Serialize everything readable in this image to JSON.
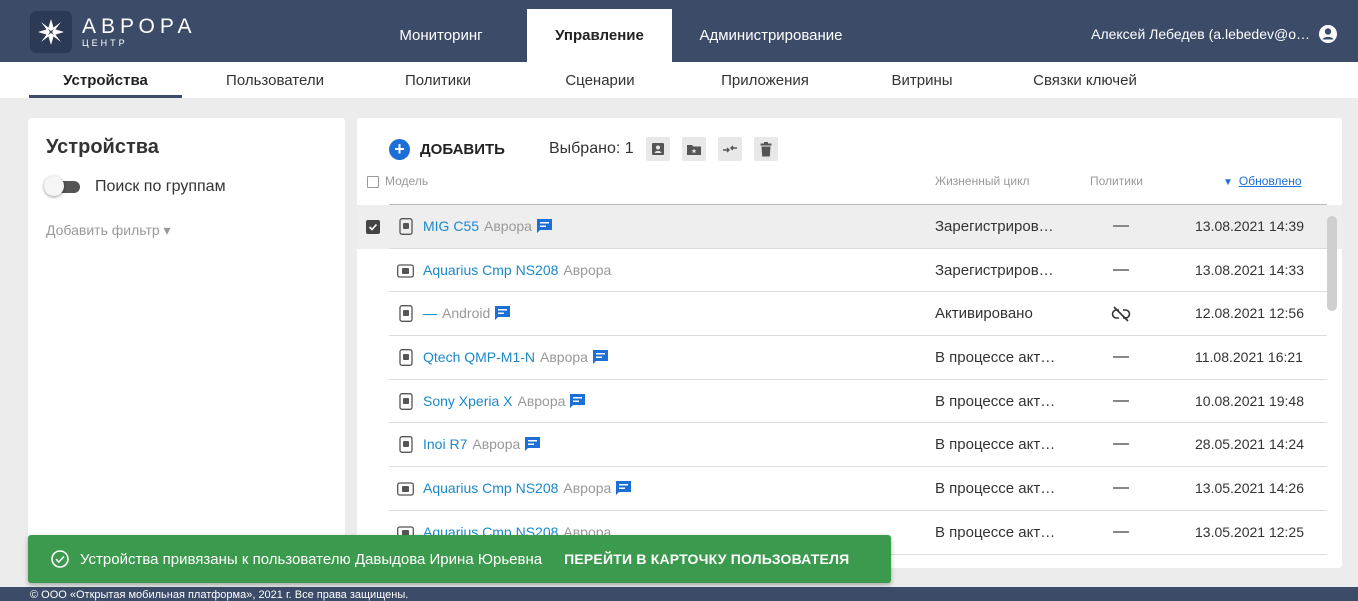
{
  "brand": {
    "name": "АВРОРА",
    "sub": "ЦЕНТР"
  },
  "main_tabs": [
    {
      "label": "Мониторинг",
      "active": false
    },
    {
      "label": "Управление",
      "active": true
    },
    {
      "label": "Администрирование",
      "active": false
    }
  ],
  "user": {
    "name": "Алексей Лебедев (a.lebedev@o…",
    "icon": "account-circle-icon"
  },
  "sub_tabs": [
    {
      "label": "Устройства",
      "active": true
    },
    {
      "label": "Пользователи",
      "active": false
    },
    {
      "label": "Политики",
      "active": false
    },
    {
      "label": "Сценарии",
      "active": false
    },
    {
      "label": "Приложения",
      "active": false
    },
    {
      "label": "Витрины",
      "active": false
    },
    {
      "label": "Связки ключей",
      "active": false
    }
  ],
  "left_panel": {
    "title": "Устройства",
    "toggle_label": "Поиск по группам",
    "add_filter": "Добавить фильтр ▾"
  },
  "toolbar": {
    "add_label": "ДОБАВИТЬ",
    "selected_text": "Выбрано: 1"
  },
  "table": {
    "headers": {
      "model": "Модель",
      "lifecycle": "Жизненный цикл",
      "policies": "Политики",
      "updated": "Обновлено"
    },
    "rows": [
      {
        "model": "MIG C55",
        "os": "Аврора",
        "device": "phone",
        "chat": true,
        "lifecycle": "Зарегистриров…",
        "policy": "—",
        "updated": "13.08.2021 14:39",
        "selected": true
      },
      {
        "model": "Aquarius Cmp NS208",
        "os": "Аврора",
        "device": "tablet",
        "chat": false,
        "lifecycle": "Зарегистриров…",
        "policy": "—",
        "updated": "13.08.2021 14:33",
        "selected": false
      },
      {
        "model": "—",
        "os": "Android",
        "device": "phone",
        "chat": true,
        "lifecycle": "Активировано",
        "policy": "unlinked",
        "updated": "12.08.2021 12:56",
        "selected": false
      },
      {
        "model": "Qtech QMP-M1-N",
        "os": "Аврора",
        "device": "phone",
        "chat": true,
        "lifecycle": "В процессе акт…",
        "policy": "—",
        "updated": "11.08.2021 16:21",
        "selected": false
      },
      {
        "model": "Sony Xperia X",
        "os": "Аврора",
        "device": "phone",
        "chat": true,
        "lifecycle": "В процессе акт…",
        "policy": "—",
        "updated": "10.08.2021 19:48",
        "selected": false
      },
      {
        "model": "Inoi R7",
        "os": "Аврора",
        "device": "phone",
        "chat": true,
        "lifecycle": "В процессе акт…",
        "policy": "—",
        "updated": "28.05.2021 14:24",
        "selected": false
      },
      {
        "model": "Aquarius Cmp NS208",
        "os": "Аврора",
        "device": "tablet",
        "chat": true,
        "lifecycle": "В процессе акт…",
        "policy": "—",
        "updated": "13.05.2021 14:26",
        "selected": false
      },
      {
        "model": "Aquarius Cmp NS208",
        "os": "Аврора",
        "device": "tablet",
        "chat": false,
        "lifecycle": "В процессе акт…",
        "policy": "—",
        "updated": "13.05.2021 12:25",
        "selected": false
      }
    ]
  },
  "toast": {
    "message": "Устройства привязаны к пользователю Давыдова Ирина Юрьевна",
    "action": "ПЕРЕЙТИ В КАРТОЧКУ ПОЛЬЗОВАТЕЛЯ"
  },
  "footer": {
    "text": "© ООО «Открытая мобильная платформа», 2021 г. Все права защищены."
  },
  "colors": {
    "header": "#3c4b68",
    "accent": "#1b6fd6",
    "link": "#1b88c9",
    "toast": "#3c9a4e"
  }
}
